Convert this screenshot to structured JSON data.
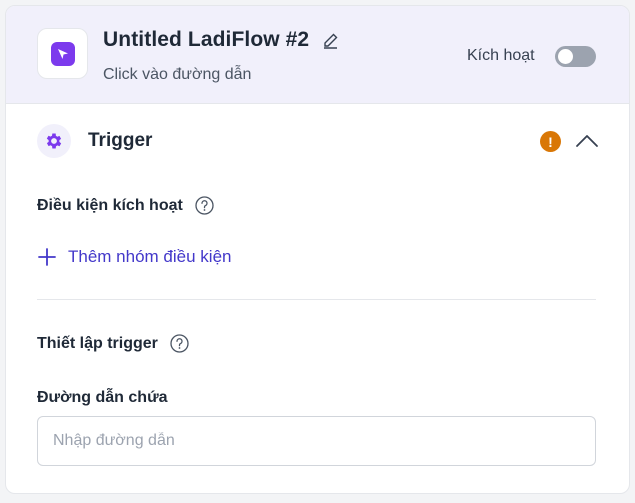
{
  "header": {
    "title": "Untitled LadiFlow #2",
    "subtitle": "Click vào đường dẫn",
    "activate_label": "Kích hoạt",
    "toggle_on": false,
    "app_icon": "cursor-click-icon",
    "edit_icon": "pencil-icon"
  },
  "trigger_section": {
    "title": "Trigger",
    "icon": "gear-icon",
    "warning_icon": "exclamation-icon",
    "collapse_icon": "chevron-up-icon",
    "conditions": {
      "label": "Điều kiện kích hoạt",
      "add_group_label": "Thêm nhóm điều kiện"
    },
    "setup": {
      "label": "Thiết lập trigger"
    },
    "url_field": {
      "label": "Đường dẫn chứa",
      "placeholder": "Nhập đường dẫn",
      "value": ""
    }
  },
  "colors": {
    "accent": "#7c3aed",
    "link": "#4338ca",
    "warning": "#d97706",
    "header_bg": "#f1f0fb"
  }
}
